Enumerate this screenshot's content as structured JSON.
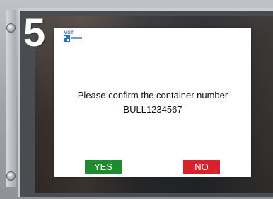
{
  "overlay": {
    "step_number": "5"
  },
  "dialog": {
    "logo_text": "MGT",
    "message_line1": "Please confirm the container number",
    "message_line2": "BULL1234567",
    "yes_label": "YES",
    "no_label": "NO"
  },
  "colors": {
    "yes_button": "#1f8a2e",
    "no_button": "#d9212b",
    "dialog_bg": "#ffffff",
    "logo": "#2f6fb8"
  }
}
